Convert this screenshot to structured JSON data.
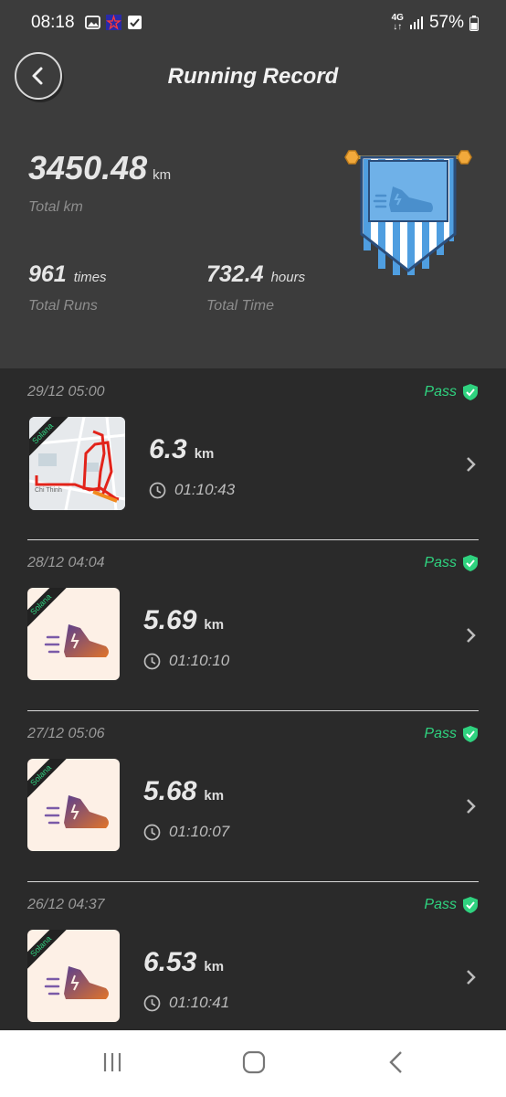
{
  "status_bar": {
    "time": "08:18",
    "network": "4G",
    "battery": "57%"
  },
  "header": {
    "title": "Running Record"
  },
  "summary": {
    "total_km_value": "3450.48",
    "total_km_unit": "km",
    "total_km_label": "Total km",
    "runs_value": "961",
    "runs_unit": "times",
    "runs_label": "Total Runs",
    "time_value": "732.4",
    "time_unit": "hours",
    "time_label": "Total Time"
  },
  "records": [
    {
      "date": "29/12 05:00",
      "status": "Pass",
      "distance": "6.3",
      "unit": "km",
      "duration": "01:10:43",
      "thumb_tag": "Solana",
      "map_label": "Chi Thinh"
    },
    {
      "date": "28/12 04:04",
      "status": "Pass",
      "distance": "5.69",
      "unit": "km",
      "duration": "01:10:10",
      "thumb_tag": "Solana"
    },
    {
      "date": "27/12 05:06",
      "status": "Pass",
      "distance": "5.68",
      "unit": "km",
      "duration": "01:10:07",
      "thumb_tag": "Solana"
    },
    {
      "date": "26/12 04:37",
      "status": "Pass",
      "distance": "6.53",
      "unit": "km",
      "duration": "01:10:41",
      "thumb_tag": "Solana"
    }
  ],
  "colors": {
    "pass": "#2fd27f",
    "header_bg": "#3c3c3c",
    "list_bg": "#2a2a2a"
  }
}
